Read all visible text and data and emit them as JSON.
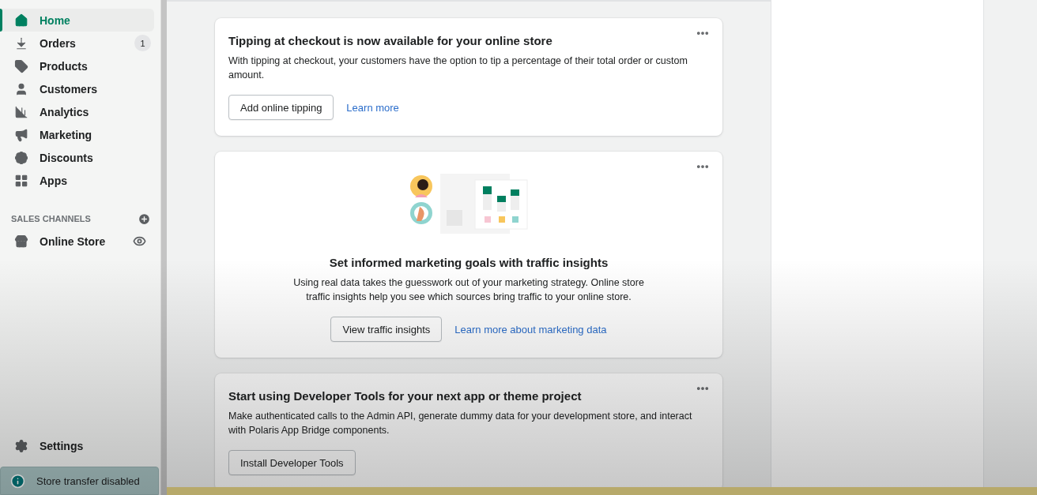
{
  "sidebar": {
    "items": [
      {
        "label": "Home",
        "selected": true
      },
      {
        "label": "Orders",
        "selected": false,
        "badge": "1"
      },
      {
        "label": "Products",
        "selected": false
      },
      {
        "label": "Customers",
        "selected": false
      },
      {
        "label": "Analytics",
        "selected": false
      },
      {
        "label": "Marketing",
        "selected": false
      },
      {
        "label": "Discounts",
        "selected": false
      },
      {
        "label": "Apps",
        "selected": false
      }
    ],
    "sales_channels": {
      "heading": "SALES CHANNELS",
      "items": [
        {
          "label": "Online Store",
          "selected": false
        }
      ]
    },
    "settings": {
      "label": "Settings",
      "selected": false
    },
    "notice": "Store transfer disabled"
  },
  "cards": [
    {
      "kind": "plain",
      "title": "Tipping at checkout is now available for your online store",
      "body": "With tipping at checkout, your customers have the option to tip a percentage of their total order or custom amount.",
      "button": "Add online tipping",
      "link": "Learn more"
    },
    {
      "kind": "centered",
      "title": "Set informed marketing goals with traffic insights",
      "body": "Using real data takes the guesswork out of your marketing strategy. Online store traffic insights help you see which sources bring traffic to your online store.",
      "button": "View traffic insights",
      "link": "Learn more about marketing data"
    },
    {
      "kind": "plain",
      "title": "Start using Developer Tools for your next app or theme project",
      "body": "Make authenticated calls to the Admin API, generate dummy data for your development store, and interact with Polaris App Bridge components.",
      "button": "Install Developer Tools"
    }
  ]
}
